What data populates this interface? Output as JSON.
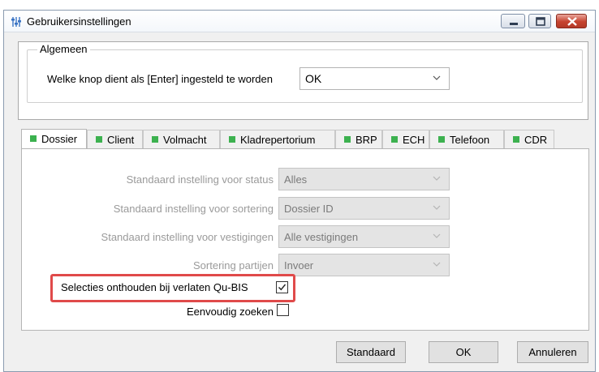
{
  "window": {
    "title": "Gebruikersinstellingen"
  },
  "general": {
    "legend": "Algemeen",
    "enter_label": "Welke knop dient als [Enter] ingesteld te worden",
    "enter_value": "OK"
  },
  "tabs": [
    {
      "label": "Dossier",
      "active": true
    },
    {
      "label": "Client"
    },
    {
      "label": "Volmacht"
    },
    {
      "label": "Kladrepertorium"
    },
    {
      "label": "BRP"
    },
    {
      "label": "ECH"
    },
    {
      "label": "Telefoon"
    },
    {
      "label": "CDR"
    }
  ],
  "dossier": {
    "fields": [
      {
        "label": "Standaard instelling voor status",
        "value": "Alles"
      },
      {
        "label": "Standaard instelling voor sortering",
        "value": "Dossier ID"
      },
      {
        "label": "Standaard instelling voor vestigingen",
        "value": "Alle vestigingen"
      },
      {
        "label": "Sortering partijen",
        "value": "Invoer"
      }
    ],
    "remember_label": "Selecties onthouden bij verlaten Qu-BIS",
    "remember_checked": true,
    "simple_search_label": "Eenvoudig zoeken",
    "simple_search_checked": false
  },
  "buttons": {
    "standard": "Standaard",
    "ok": "OK",
    "cancel": "Annuleren"
  },
  "colors": {
    "tab_marker": "#3cb14f",
    "highlight": "#e04a4a",
    "close_button": "#c6432f"
  }
}
